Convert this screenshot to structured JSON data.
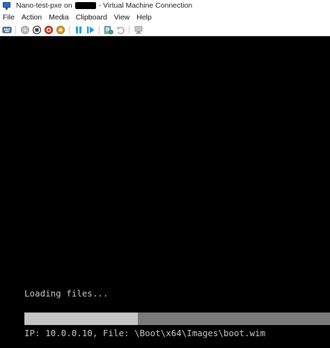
{
  "window": {
    "title_prefix": "Nano-test-pxe on",
    "title_suffix": "- Virtual Machine Connection"
  },
  "menu": {
    "items": [
      {
        "label": "File"
      },
      {
        "label": "Action"
      },
      {
        "label": "Media"
      },
      {
        "label": "Clipboard"
      },
      {
        "label": "View"
      },
      {
        "label": "Help"
      }
    ]
  },
  "toolbar": {
    "buttons": [
      {
        "icon": "ctrl-alt-del-icon"
      },
      {
        "icon": "start-icon"
      },
      {
        "icon": "turn-off-icon"
      },
      {
        "icon": "shutdown-icon"
      },
      {
        "icon": "save-icon"
      },
      {
        "icon": "pause-icon"
      },
      {
        "icon": "resume-icon"
      },
      {
        "icon": "checkpoint-icon"
      },
      {
        "icon": "revert-icon"
      },
      {
        "icon": "enhanced-session-icon"
      }
    ],
    "colors": {
      "pause_resume": "#1ea0d8",
      "shutdown": "#d03c2a",
      "save": "#e0a020",
      "disabled": "#a8a8a8"
    }
  },
  "console": {
    "loading_text": "Loading files...",
    "progress_fraction": 0.372,
    "status_line": "IP: 10.0.0.10, File: \\Boot\\x64\\Images\\boot.wim"
  }
}
